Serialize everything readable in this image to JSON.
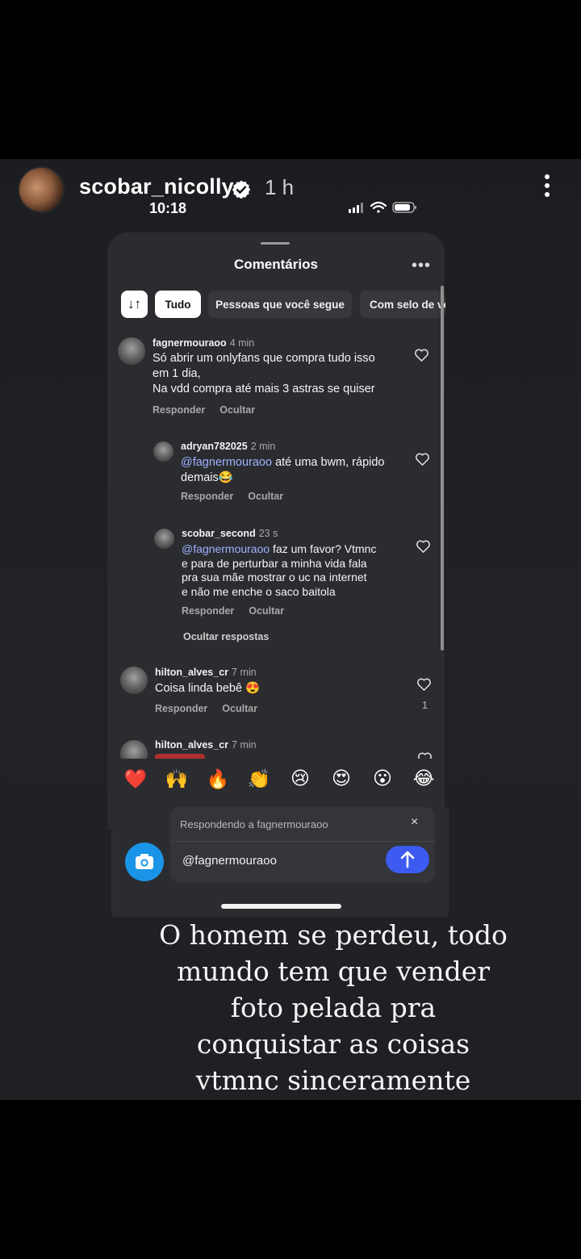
{
  "story": {
    "username": "scobar_nicolly",
    "time_ago": "1 h",
    "verified_icon": "verified-badge-icon",
    "more_icon": "kebab-menu-icon"
  },
  "screenshot": {
    "status_time": "10:18",
    "sheet_title": "Comentários",
    "sheet_more": "•••",
    "filters": {
      "sort_icon": "↓↑",
      "all": "Tudo",
      "following": "Pessoas que você segue",
      "verified": "Com selo de ve"
    },
    "comments": [
      {
        "user": "fagnermouraoo",
        "time": "4 min",
        "line1": "Só abrir um onlyfans que compra tudo isso",
        "line2": "em 1 dia,",
        "line3": "Na vdd compra até mais 3 astras se quiser",
        "reply": "Responder",
        "hide": "Ocultar"
      },
      {
        "user": "adryan782025",
        "time": "2 min",
        "mention": "@fagnermouraoo",
        "text_a": " até uma bwm, rápido",
        "text_b": "demais😂",
        "reply": "Responder",
        "hide": "Ocultar"
      },
      {
        "user": "scobar_second",
        "time": "23 s",
        "mention": "@fagnermouraoo",
        "text_a": " faz um favor? Vtmnc",
        "text_b": "e para de perturbar a minha vida fala",
        "text_c": "pra sua mãe mostrar o uc na internet",
        "text_d": "e não me enche o saco baitola",
        "reply": "Responder",
        "hide": "Ocultar"
      },
      {
        "user": "hilton_alves_cr",
        "time": "7 min",
        "text": "Coisa linda bebê 😍",
        "reply": "Responder",
        "hide": "Ocultar",
        "likes": "1"
      },
      {
        "user": "hilton_alves_cr",
        "time": "7 min"
      }
    ],
    "hide_replies": "Ocultar respostas",
    "emojis": [
      "❤️",
      "🙌",
      "🔥",
      "👏",
      "😢",
      "😍",
      "😮",
      "😂"
    ],
    "replying_to": "Respondendo a fagnermouraoo",
    "close": "×",
    "input_value": "@fagnermouraoo"
  },
  "caption": {
    "line1": "O homem se perdeu, todo",
    "line2": "mundo tem que vender",
    "line3": "foto pelada pra",
    "line4": "conquistar as coisas",
    "line5": "vtmnc sinceramente"
  },
  "colors": {
    "mention": "#9db3ff",
    "send_button": "#3d5bf0",
    "camera_button": "#1a94e6",
    "verified_badge": "#ffffff"
  }
}
